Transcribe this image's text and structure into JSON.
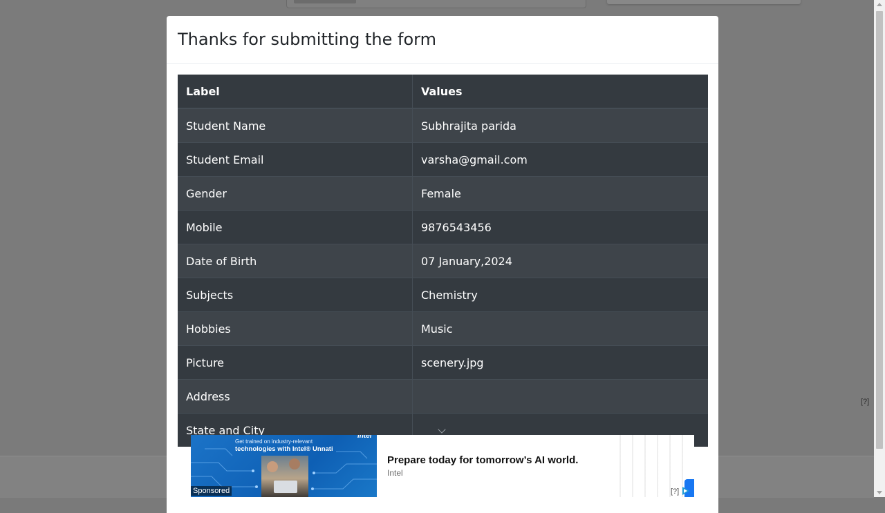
{
  "modal": {
    "title": "Thanks for submitting the form"
  },
  "table": {
    "headers": [
      "Label",
      "Values"
    ],
    "rows": [
      {
        "label": "Student Name",
        "value": "Subhrajita parida"
      },
      {
        "label": "Student Email",
        "value": "varsha@gmail.com"
      },
      {
        "label": "Gender",
        "value": "Female"
      },
      {
        "label": "Mobile",
        "value": "9876543456"
      },
      {
        "label": "Date of Birth",
        "value": "07 January,2024"
      },
      {
        "label": "Subjects",
        "value": "Chemistry"
      },
      {
        "label": "Hobbies",
        "value": "Music"
      },
      {
        "label": "Picture",
        "value": "scenery.jpg"
      },
      {
        "label": "Address",
        "value": ""
      },
      {
        "label": "State and City",
        "value": ""
      }
    ]
  },
  "background": {
    "help_marker": "[?]"
  },
  "ad": {
    "brand_mark": "intel",
    "image_line1": "Get trained on industry-relevant",
    "image_line2": "technologies with Intel® Unnati",
    "sponsored_label": "Sponsored",
    "headline": "Prepare today for tomorrow’s AI world.",
    "advertiser": "Intel",
    "help_marker": "[?]"
  },
  "colors": {
    "table_dark": "#343a40",
    "table_stripe": "#3e444a",
    "overlay": "#7b7b7b",
    "cta_blue": "#1877f2"
  }
}
